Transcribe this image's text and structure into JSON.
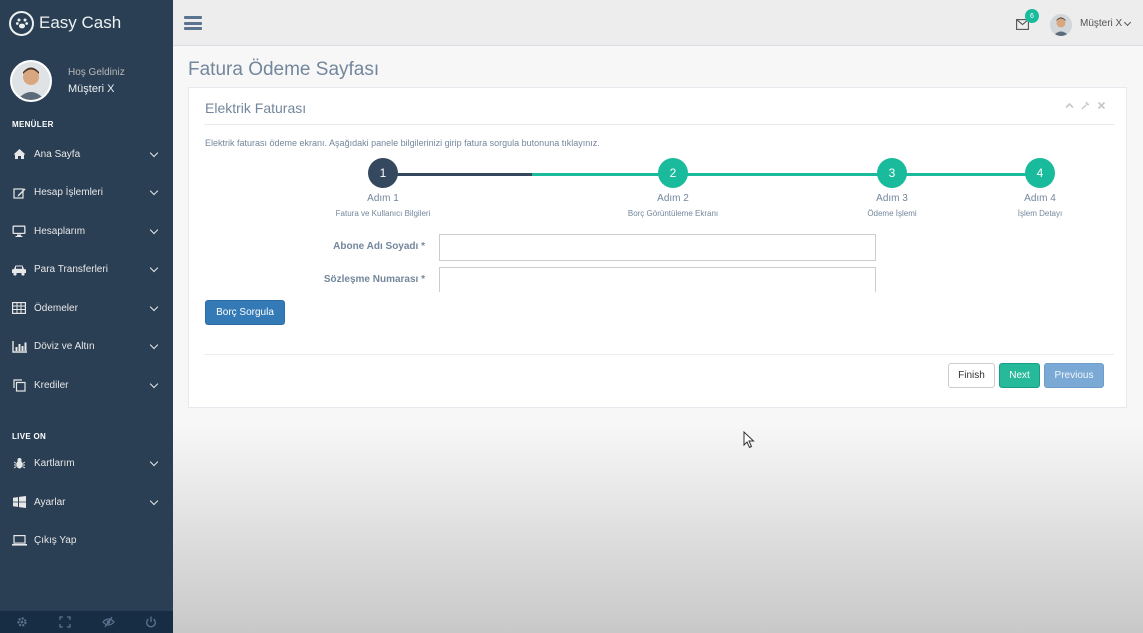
{
  "brand": {
    "title": "Easy Cash",
    "icon": "paw-icon"
  },
  "profile": {
    "welcome": "Hoş Geldiniz",
    "name": "Müşteri X"
  },
  "sidebar": {
    "section_menus": "MENÜLER",
    "menus": [
      {
        "label": "Ana Sayfa",
        "icon": "home-icon"
      },
      {
        "label": "Hesap İşlemleri",
        "icon": "edit-icon"
      },
      {
        "label": "Hesaplarım",
        "icon": "desktop-icon"
      },
      {
        "label": "Para Transferleri",
        "icon": "car-icon"
      },
      {
        "label": "Ödemeler",
        "icon": "table-icon"
      },
      {
        "label": "Döviz ve Altın",
        "icon": "bar-chart-icon"
      },
      {
        "label": "Krediler",
        "icon": "clone-icon"
      }
    ],
    "section_live": "LIVE ON",
    "live": [
      {
        "label": "Kartlarım",
        "icon": "bug-icon",
        "has_chevron": true
      },
      {
        "label": "Ayarlar",
        "icon": "windows-icon",
        "has_chevron": true
      },
      {
        "label": "Çıkış Yap",
        "icon": "laptop-icon",
        "has_chevron": false
      }
    ],
    "footer_icons": [
      "settings-icon",
      "fullscreen-icon",
      "eye-slash-icon",
      "power-icon"
    ]
  },
  "topnav": {
    "mail_badge": "6",
    "user_name": "Müşteri X"
  },
  "page": {
    "title": "Fatura Ödeme Sayfası",
    "panel_title": "Elektrik Faturası",
    "description": "Elektrik faturası ödeme ekranı. Aşağıdaki panele bilgilerinizi girip fatura sorgula butonuna tıklayınız."
  },
  "wizard": {
    "steps": [
      {
        "number": "1",
        "title": "Adım 1",
        "desc": "Fatura ve Kullanıcı Bilgileri",
        "state": "active"
      },
      {
        "number": "2",
        "title": "Adım 2",
        "desc": "Borç Görüntüleme Ekranı",
        "state": "done"
      },
      {
        "number": "3",
        "title": "Adım 3",
        "desc": "Ödeme İşlemi",
        "state": "done"
      },
      {
        "number": "4",
        "title": "Adım 4",
        "desc": "İşlem Detayı",
        "state": "done"
      }
    ],
    "colors": {
      "active": "#34495e",
      "done": "#1abb9c"
    }
  },
  "form": {
    "subscriber_label": "Abone Adı Soyadı *",
    "subscriber_value": "",
    "contract_label": "Sözleşme Numarası *",
    "contract_value": "",
    "query_button": "Borç Sorgula"
  },
  "actions": {
    "finish": "Finish",
    "next": "Next",
    "previous": "Previous"
  }
}
